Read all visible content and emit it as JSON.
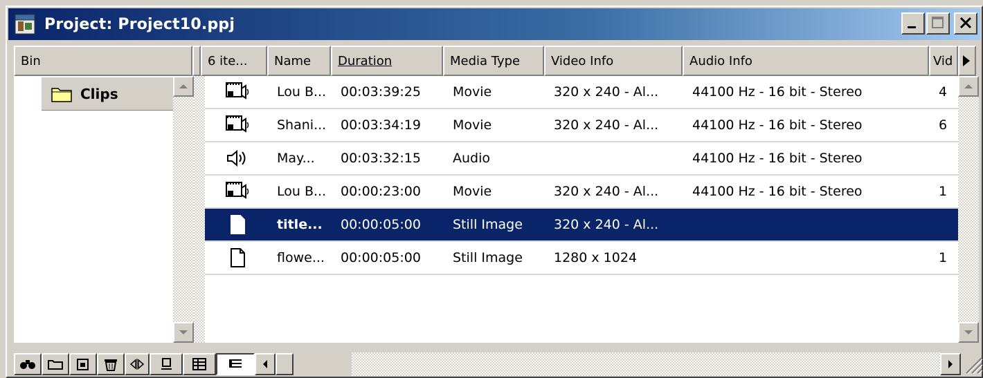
{
  "window": {
    "title": "Project: Project10.ppj",
    "icon": "project-icon",
    "controls": [
      "minimize-icon",
      "maximize-icon",
      "close-icon"
    ]
  },
  "bin": {
    "header": "Bin",
    "folders": [
      {
        "label": "Clips",
        "icon": "folder-icon"
      }
    ]
  },
  "columns": {
    "count": "6 ite...",
    "name": "Name",
    "duration": "Duration",
    "media_type": "Media Type",
    "video_info": "Video Info",
    "audio_info": "Audio Info",
    "video_inpoint": "Vid"
  },
  "rows": [
    {
      "icon": "movie-icon",
      "name": "Lou B...",
      "duration": "00:03:39:25",
      "media_type": "Movie",
      "video_info": "320 x 240 - Al...",
      "audio_info": "44100 Hz - 16 bit - Stereo",
      "vi": "4"
    },
    {
      "icon": "movie-icon",
      "name": "Shani...",
      "duration": "00:03:34:19",
      "media_type": "Movie",
      "video_info": "320 x 240 - Al...",
      "audio_info": "44100 Hz - 16 bit - Stereo",
      "vi": "6"
    },
    {
      "icon": "audio-icon",
      "name": "May...",
      "duration": "00:03:32:15",
      "media_type": "Audio",
      "video_info": "",
      "audio_info": "44100 Hz - 16 bit - Stereo",
      "vi": ""
    },
    {
      "icon": "movie-icon",
      "name": "Lou B...",
      "duration": "00:00:23:00",
      "media_type": "Movie",
      "video_info": "320 x 240 - Al...",
      "audio_info": "44100 Hz - 16 bit - Stereo",
      "vi": "1"
    },
    {
      "icon": "still-image-icon",
      "name": "title...",
      "duration": "00:00:05:00",
      "media_type": "Still Image",
      "video_info": "320 x 240 - Al...",
      "audio_info": "",
      "vi": "",
      "selected": true
    },
    {
      "icon": "still-image-icon",
      "name": "flowe...",
      "duration": "00:00:05:00",
      "media_type": "Still Image",
      "video_info": "1280 x 1024",
      "audio_info": "",
      "vi": "1"
    }
  ],
  "toolbar": {
    "buttons": [
      "find-icon",
      "new-bin-icon",
      "new-item-icon",
      "delete-icon"
    ],
    "views": [
      "icon-view-icon",
      "thumbnail-view-icon",
      "list-view-icon"
    ],
    "active_view": "list-view-icon"
  },
  "colors": {
    "title_bar": "#0a246a",
    "selection": "#0a246a",
    "chrome": "#d4d0c8"
  }
}
